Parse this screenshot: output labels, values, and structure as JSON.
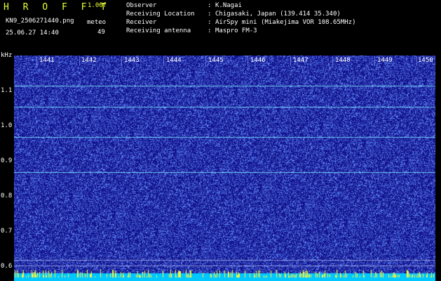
{
  "header": {
    "brand": "H R O F F T",
    "version": "1.00f",
    "filename": "KN9_2506271440.png",
    "datetime": "25.06.27 14:40",
    "meteor_label": "meteo",
    "meteor_count": "49"
  },
  "info": [
    {
      "label": "Observer",
      "value": "K.Nagai"
    },
    {
      "label": "Receiving Location",
      "value": "Chigasaki, Japan (139.414 35.340)"
    },
    {
      "label": "Receiver",
      "value": "AirSpy mini (Miakejima VOR 108.65MHz)"
    },
    {
      "label": "Receiving antenna",
      "value": "Maspro FM-3"
    }
  ],
  "y_axis": {
    "unit": "kHz",
    "ticks": [
      "1.1",
      "1.0",
      "0.9",
      "0.8",
      "0.7",
      "0.6"
    ]
  },
  "x_axis": {
    "ticks": [
      "1441",
      "1442",
      "1443",
      "1444",
      "1445",
      "1446",
      "1447",
      "1448",
      "1449",
      "1450"
    ]
  },
  "colors": {
    "background": "#000000",
    "spectrogram_base": "#12128a",
    "noise": "#5a7aff",
    "signal_line": "#7fe8ff",
    "bottom_band": "#00c8ff",
    "spikes": "#f5f540"
  }
}
